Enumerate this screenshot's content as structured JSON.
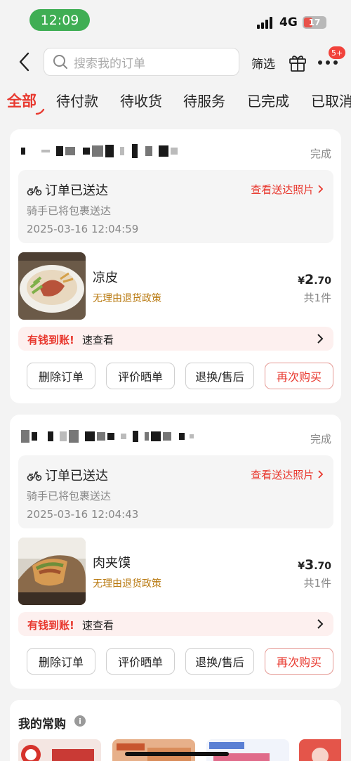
{
  "status": {
    "time": "12:09",
    "network": "4G",
    "battery": "17"
  },
  "header": {
    "search_placeholder": "搜索我的订单",
    "filter_label": "筛选",
    "more_badge": "5+"
  },
  "tabs": [
    "全部",
    "待付款",
    "待收货",
    "待服务",
    "已完成",
    "已取消"
  ],
  "orders": [
    {
      "status": "完成",
      "delivery_title": "订单已送达",
      "delivery_link": "查看送达照片",
      "delivery_sub": "骑手已将包裹送达",
      "delivery_time": "2025-03-16 12:04:59",
      "item_name": "凉皮",
      "item_policy": "无理由退货政策",
      "price_currency": "¥",
      "price_int": "2",
      "price_dec": ".70",
      "qty": "共1件",
      "promo_highlight": "有钱到账!",
      "promo_text": "速查看",
      "buttons": [
        "删除订单",
        "评价晒单",
        "退换/售后",
        "再次购买"
      ]
    },
    {
      "status": "完成",
      "delivery_title": "订单已送达",
      "delivery_link": "查看送达照片",
      "delivery_sub": "骑手已将包裹送达",
      "delivery_time": "2025-03-16 12:04:43",
      "item_name": "肉夹馍",
      "item_policy": "无理由退货政策",
      "price_currency": "¥",
      "price_int": "3",
      "price_dec": ".70",
      "qty": "共1件",
      "promo_highlight": "有钱到账!",
      "promo_text": "速查看",
      "buttons": [
        "删除订单",
        "评价晒单",
        "退换/售后",
        "再次购买"
      ]
    }
  ],
  "frequent": {
    "title": "我的常购",
    "info": "i"
  },
  "colors": {
    "accent": "#e8382e",
    "promo_bg": "#fdf0ef",
    "policy": "#b8780e"
  }
}
